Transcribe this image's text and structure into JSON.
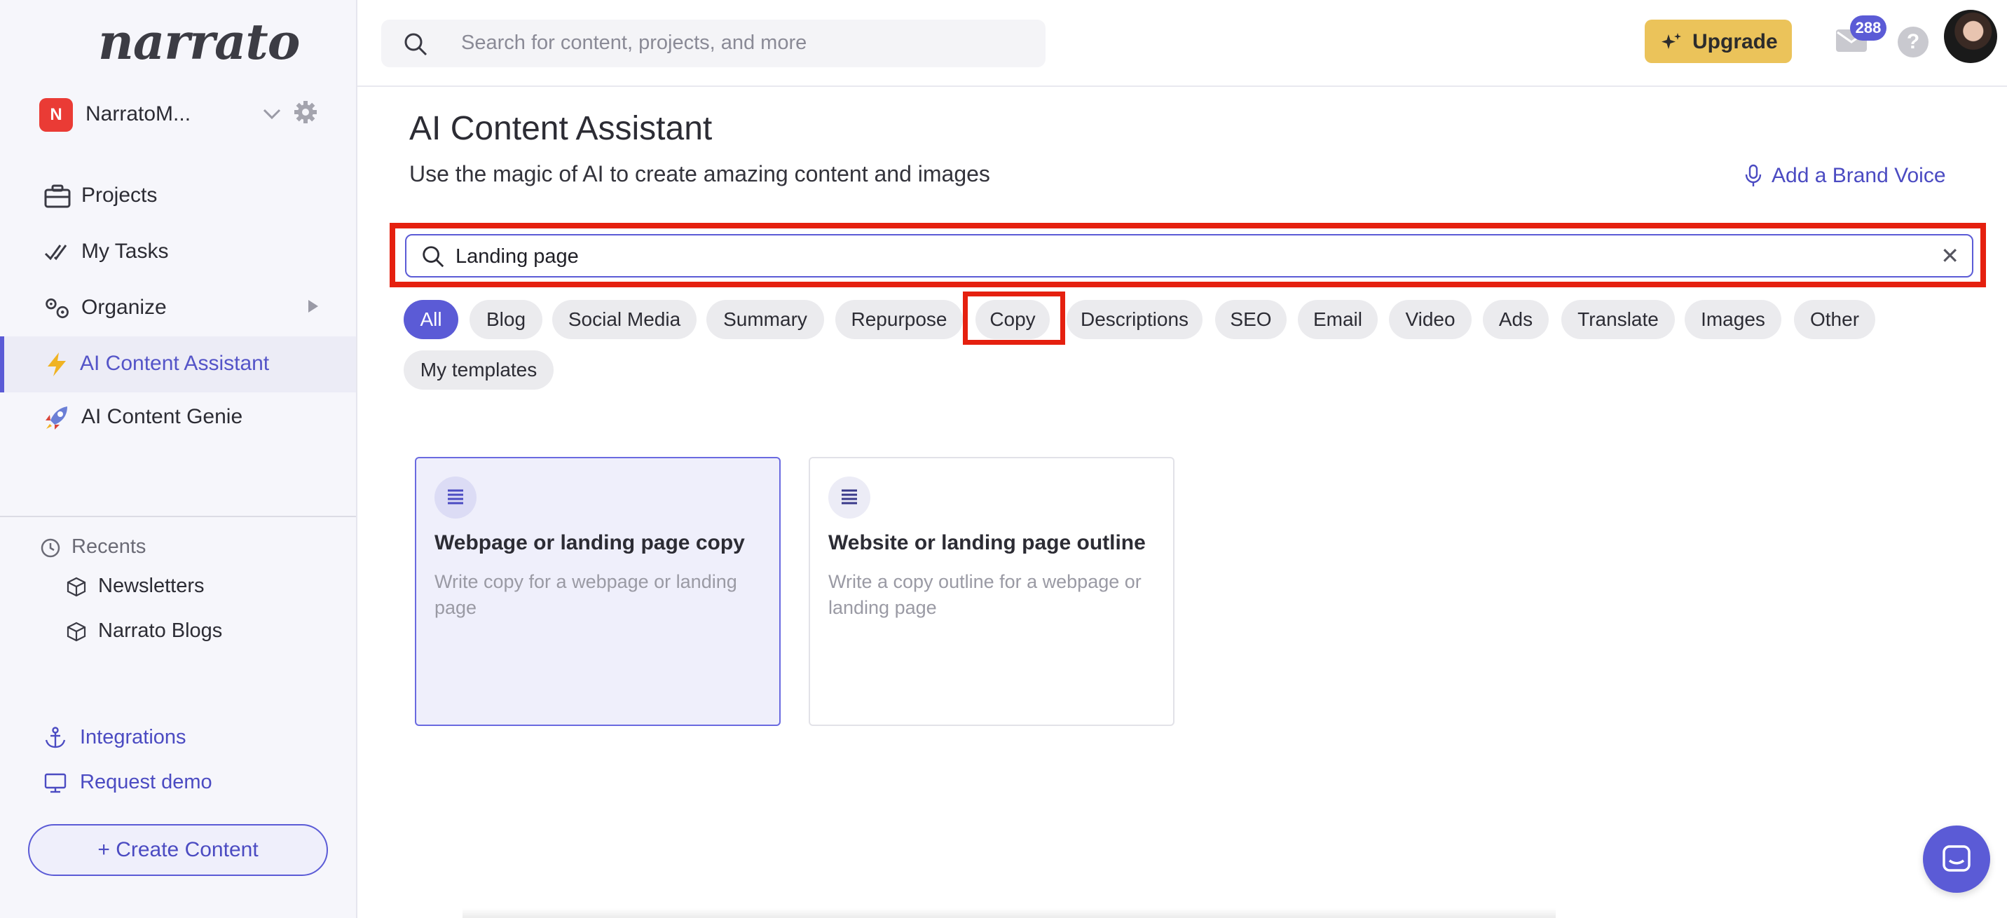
{
  "app": {
    "logo_text": "narrato"
  },
  "workspace": {
    "badge": "N",
    "name": "NarratoM..."
  },
  "sidebar": {
    "nav": [
      {
        "label": "Projects",
        "icon": "briefcase-icon"
      },
      {
        "label": "My Tasks",
        "icon": "checkmarks-icon"
      },
      {
        "label": "Organize",
        "icon": "gears-icon"
      },
      {
        "label": "AI Content Assistant",
        "icon": "lightning-icon",
        "active": true
      },
      {
        "label": "AI Content Genie",
        "icon": "rocket-icon"
      }
    ],
    "recents_label": "Recents",
    "recents": [
      {
        "label": "Newsletters",
        "icon": "cube-icon"
      },
      {
        "label": "Narrato Blogs",
        "icon": "cube-icon"
      }
    ],
    "links": [
      {
        "label": "Integrations",
        "icon": "anchor-icon"
      },
      {
        "label": "Request demo",
        "icon": "monitor-icon"
      }
    ],
    "create_label": "+ Create Content"
  },
  "topbar": {
    "search_placeholder": "Search for content, projects, and more",
    "upgrade_label": "Upgrade",
    "mail_count": "288",
    "help_label": "?"
  },
  "main": {
    "title": "AI Content Assistant",
    "subtitle": "Use the magic of AI to create amazing content and images",
    "brand_voice_label": "Add a Brand Voice",
    "search_value": "Landing page",
    "clear_label": "✕",
    "filters": [
      "All",
      "Blog",
      "Social Media",
      "Summary",
      "Repurpose",
      "Copy",
      "Descriptions",
      "SEO",
      "Email",
      "Video",
      "Ads",
      "Translate",
      "Images",
      "Other",
      "My templates"
    ],
    "active_filter": "All",
    "cards": [
      {
        "title": "Webpage or landing page copy",
        "description": "Write copy for a webpage or landing page",
        "icon": "text-lines-icon",
        "selected": true
      },
      {
        "title": "Website or landing page outline",
        "description": "Write a copy outline for a webpage or landing page",
        "icon": "text-lines-icon",
        "selected": false
      }
    ]
  },
  "colors": {
    "accent": "#5b5bd6",
    "highlight": "#e5200f",
    "upgrade": "#ebc35a",
    "workspace_badge": "#ea3b35"
  }
}
